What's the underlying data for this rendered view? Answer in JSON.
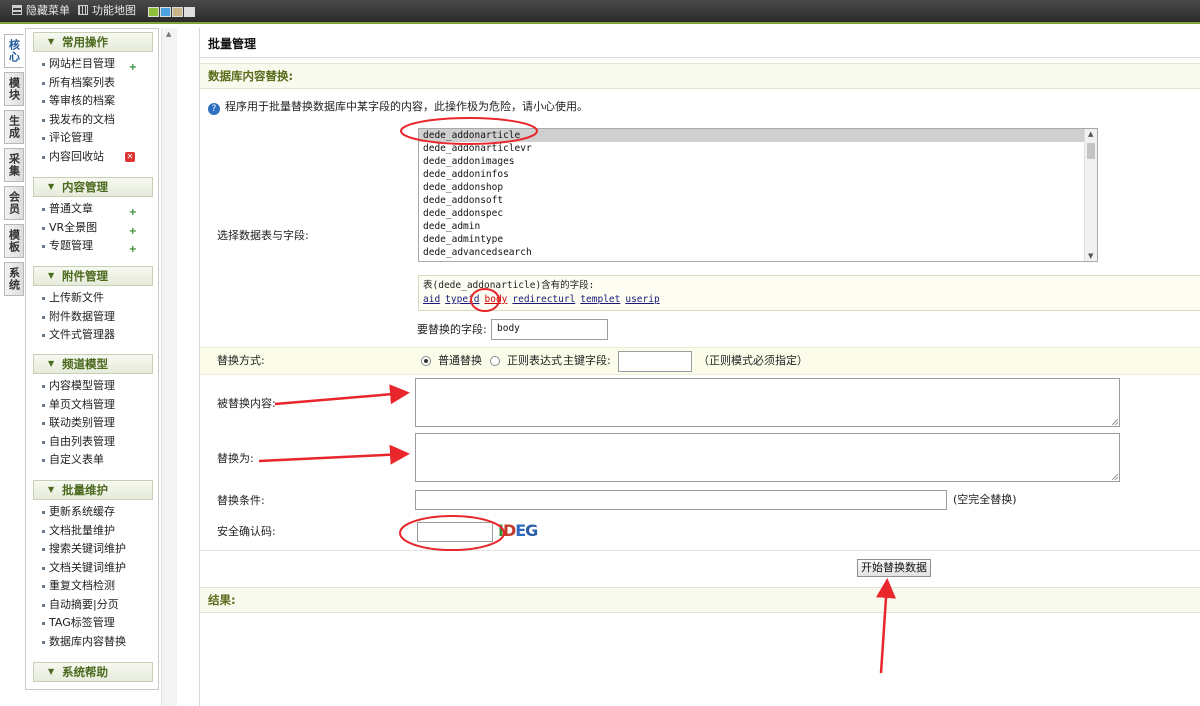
{
  "topbar": {
    "hide_menu": "隐藏菜单",
    "site_map": "功能地图",
    "skin_colors": [
      "#8fbf3a",
      "#4aa3df",
      "#c8b68a",
      "#dddddd"
    ]
  },
  "vtabs": [
    "核心",
    "模块",
    "生成",
    "采集",
    "会员",
    "模板",
    "系统"
  ],
  "sidebar": {
    "groups": [
      {
        "title": "常用操作",
        "items": [
          "网站栏目管理",
          "所有档案列表",
          "等审核的档案",
          "我发布的文档",
          "评论管理",
          "内容回收站"
        ]
      },
      {
        "title": "内容管理",
        "items": [
          "普通文章",
          "VR全景图",
          "专题管理"
        ]
      },
      {
        "title": "附件管理",
        "items": [
          "上传新文件",
          "附件数据管理",
          "文件式管理器"
        ]
      },
      {
        "title": "频道模型",
        "items": [
          "内容模型管理",
          "单页文档管理",
          "联动类别管理",
          "自由列表管理",
          "自定义表单"
        ]
      },
      {
        "title": "批量维护",
        "items": [
          "更新系统缓存",
          "文档批量维护",
          "搜索关键词维护",
          "文档关键词维护",
          "重复文档检测",
          "自动摘要|分页",
          "TAG标签管理",
          "数据库内容替换"
        ]
      },
      {
        "title": "系统帮助",
        "items": []
      }
    ]
  },
  "main": {
    "page_title": "批量管理",
    "section_title": "数据库内容替换:",
    "notice": "程序用于批量替换数据库中某字段的内容，此操作极为危险，请小心使用。",
    "select_table_label": "选择数据表与字段:",
    "tables": [
      "dede_addonarticle",
      "dede_addonarticlevr",
      "dede_addonimages",
      "dede_addoninfos",
      "dede_addonshop",
      "dede_addonsoft",
      "dede_addonspec",
      "dede_admin",
      "dede_admintype",
      "dede_advancedsearch"
    ],
    "selected_table": "dede_addonarticle",
    "fields_title": "表(dede_addonarticle)含有的字段:",
    "fields": [
      "aid",
      "typeid",
      "body",
      "redirecturl",
      "templet",
      "userip"
    ],
    "highlighted_field": "body",
    "replace_field_label": "要替换的字段:",
    "replace_field_value": "body",
    "mode_label": "替换方式:",
    "mode_normal": "普通替换",
    "mode_regex": "正则表达式",
    "primary_key_label": "主键字段:",
    "primary_key_hint": "（正则模式必须指定）",
    "find_label": "被替换内容:",
    "replace_label": "替换为:",
    "condition_label": "替换条件:",
    "condition_hint": "(空完全替换)",
    "captcha_label": "安全确认码:",
    "captcha_text": "IDEG",
    "submit_label": "开始替换数据",
    "result_title": "结果:"
  },
  "colors": {
    "section_bg": "#f9faee",
    "accent_green": "#5a6b1b",
    "annotation_red": "#e8262b"
  }
}
